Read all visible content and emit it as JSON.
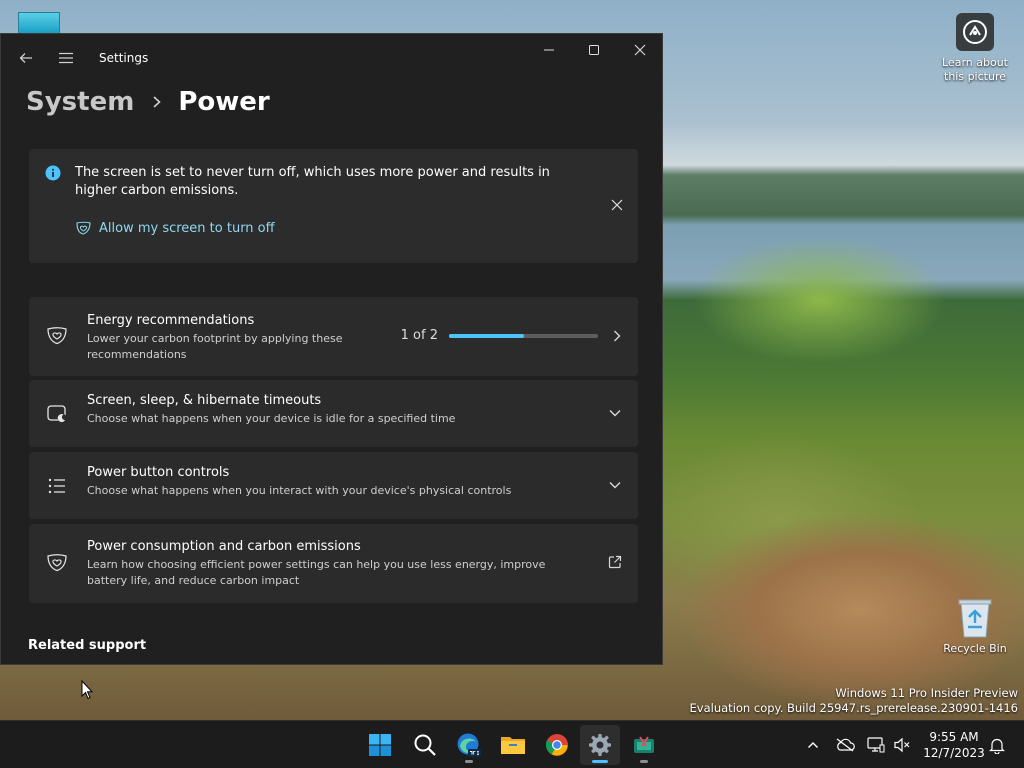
{
  "desktop": {
    "shortcuts": [
      {
        "label": "Learn about this picture",
        "icon": "camera-icon"
      },
      {
        "label": "Recycle Bin",
        "icon": "recycle-bin-icon"
      }
    ],
    "watermark": {
      "line1": "Windows 11 Pro Insider Preview",
      "line2": "Evaluation copy. Build 25947.rs_prerelease.230901-1416"
    }
  },
  "window": {
    "app_title": "Settings",
    "breadcrumb": {
      "parent": "System",
      "current": "Power"
    },
    "banner": {
      "message": "The screen is set to never turn off, which uses more power and results in higher carbon emissions.",
      "link": "Allow my screen to turn off"
    },
    "rows": [
      {
        "title": "Energy recommendations",
        "description": "Lower your carbon footprint by applying these recommendations",
        "progress_text": "1 of 2",
        "progress_value": 0.5,
        "icon": "leaf-heart-icon",
        "action": "chevron-right-icon"
      },
      {
        "title": "Screen, sleep, & hibernate timeouts",
        "description": "Choose what happens when your device is idle for a specified time",
        "icon": "screen-sleep-icon",
        "action": "chevron-down-icon"
      },
      {
        "title": "Power button controls",
        "description": "Choose what happens when you interact with your device's physical controls",
        "icon": "list-icon",
        "action": "chevron-down-icon"
      },
      {
        "title": "Power consumption and carbon emissions",
        "description": "Learn how choosing efficient power settings can help you use less energy, improve battery life, and reduce carbon impact",
        "icon": "leaf-heart-icon",
        "action": "open-external-icon"
      }
    ],
    "related_support": "Related support"
  },
  "taskbar": {
    "apps": [
      "start-icon",
      "search-icon",
      "edge-pre-icon",
      "file-explorer-icon",
      "chrome-icon",
      "settings-icon",
      "snipping-tool-icon"
    ],
    "clock": {
      "time": "9:55 AM",
      "date": "12/7/2023"
    }
  },
  "colors": {
    "accent": "#4cc2ff",
    "link": "#8fd8f0",
    "window_bg": "#202020",
    "card_bg": "#2b2b2b",
    "taskbar_bg": "#1c1c1c"
  }
}
